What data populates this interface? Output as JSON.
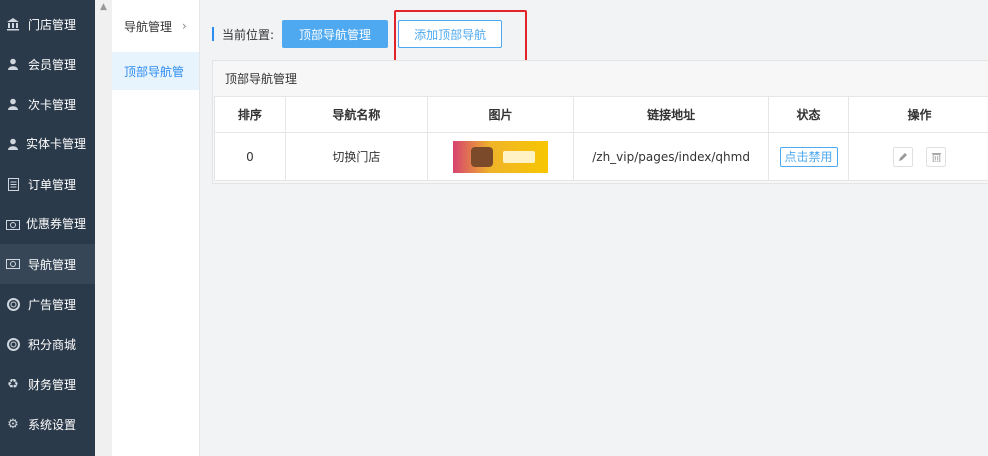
{
  "sidebar": {
    "items": [
      {
        "label": "门店管理",
        "icon": "bank-icon"
      },
      {
        "label": "会员管理",
        "icon": "user-icon"
      },
      {
        "label": "次卡管理",
        "icon": "user-icon"
      },
      {
        "label": "实体卡管理",
        "icon": "user-icon"
      },
      {
        "label": "订单管理",
        "icon": "document-icon"
      },
      {
        "label": "优惠券管理",
        "icon": "money-icon"
      },
      {
        "label": "导航管理",
        "icon": "money-icon"
      },
      {
        "label": "广告管理",
        "icon": "lifebuoy-icon"
      },
      {
        "label": "积分商城",
        "icon": "lifebuoy-icon"
      },
      {
        "label": "财务管理",
        "icon": "recycle-icon"
      },
      {
        "label": "系统设置",
        "icon": "gear-icon"
      }
    ]
  },
  "subnav": {
    "head": "导航管理",
    "active_item": "顶部导航管"
  },
  "topbar": {
    "location_label": "当前位置:",
    "current_button": "顶部导航管理",
    "add_button": "添加顶部导航"
  },
  "panel": {
    "title": "顶部导航管理",
    "columns": [
      "排序",
      "导航名称",
      "图片",
      "链接地址",
      "状态",
      "操作"
    ],
    "rows": [
      {
        "sort": "0",
        "name": "切换门店",
        "link": "/zh_vip/pages/index/qhmd",
        "status_button": "点击禁用"
      }
    ]
  },
  "colors": {
    "sidebar_bg": "#2b3a4a",
    "accent": "#4ea9f0",
    "highlight": "#e0242a"
  }
}
